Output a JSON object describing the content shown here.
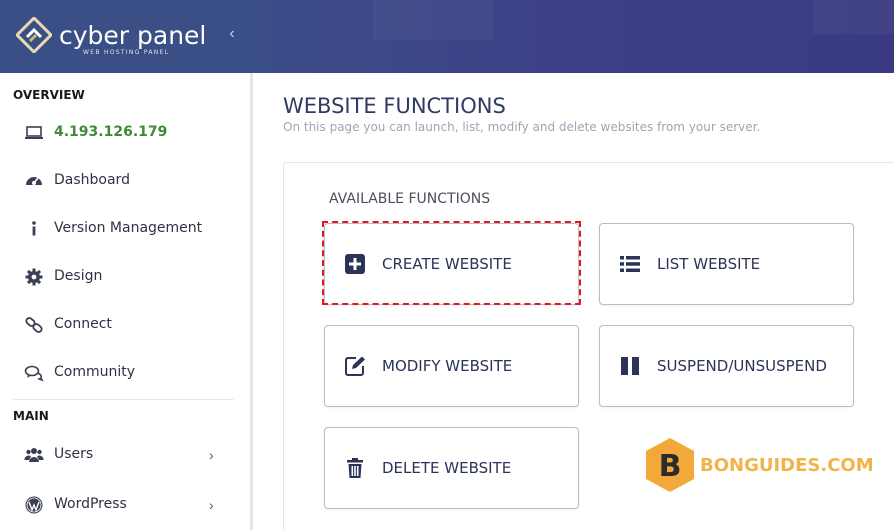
{
  "brand": {
    "name": "cyber panel",
    "tagline": "WEB HOSTING PANEL"
  },
  "sidebar": {
    "overview_label": "OVERVIEW",
    "main_label": "MAIN",
    "overview_items": [
      {
        "label": "4.193.126.179",
        "icon": "laptop-icon"
      },
      {
        "label": "Dashboard",
        "icon": "dashboard-gauge-icon"
      },
      {
        "label": "Version Management",
        "icon": "info-icon"
      },
      {
        "label": "Design",
        "icon": "gear-icon"
      },
      {
        "label": "Connect",
        "icon": "link-icon"
      },
      {
        "label": "Community",
        "icon": "chat-bubbles-icon"
      }
    ],
    "main_items": [
      {
        "label": "Users",
        "icon": "users-icon",
        "chevron": "›"
      },
      {
        "label": "WordPress",
        "icon": "wordpress-icon",
        "chevron": "›"
      }
    ],
    "collapse_glyph": "‹"
  },
  "page": {
    "title": "WEBSITE FUNCTIONS",
    "subtitle": "On this page you can launch, list, modify and delete websites from your server.",
    "panel_title": "AVAILABLE FUNCTIONS"
  },
  "functions": [
    {
      "label": "CREATE WEBSITE",
      "icon": "plus-square-icon"
    },
    {
      "label": "LIST WEBSITE",
      "icon": "list-icon"
    },
    {
      "label": "MODIFY WEBSITE",
      "icon": "edit-icon"
    },
    {
      "label": "SUSPEND/UNSUSPEND",
      "icon": "pause-icon"
    },
    {
      "label": "DELETE WEBSITE",
      "icon": "trash-icon"
    }
  ],
  "watermark": {
    "letter": "B",
    "text": "BONGUIDES.COM"
  },
  "colors": {
    "brand_bg": "#3a4f86",
    "ip_green": "#3f8a36",
    "title_navy": "#2f3b63",
    "highlight_red": "#e0181f",
    "watermark_orange": "#f2b34a"
  }
}
